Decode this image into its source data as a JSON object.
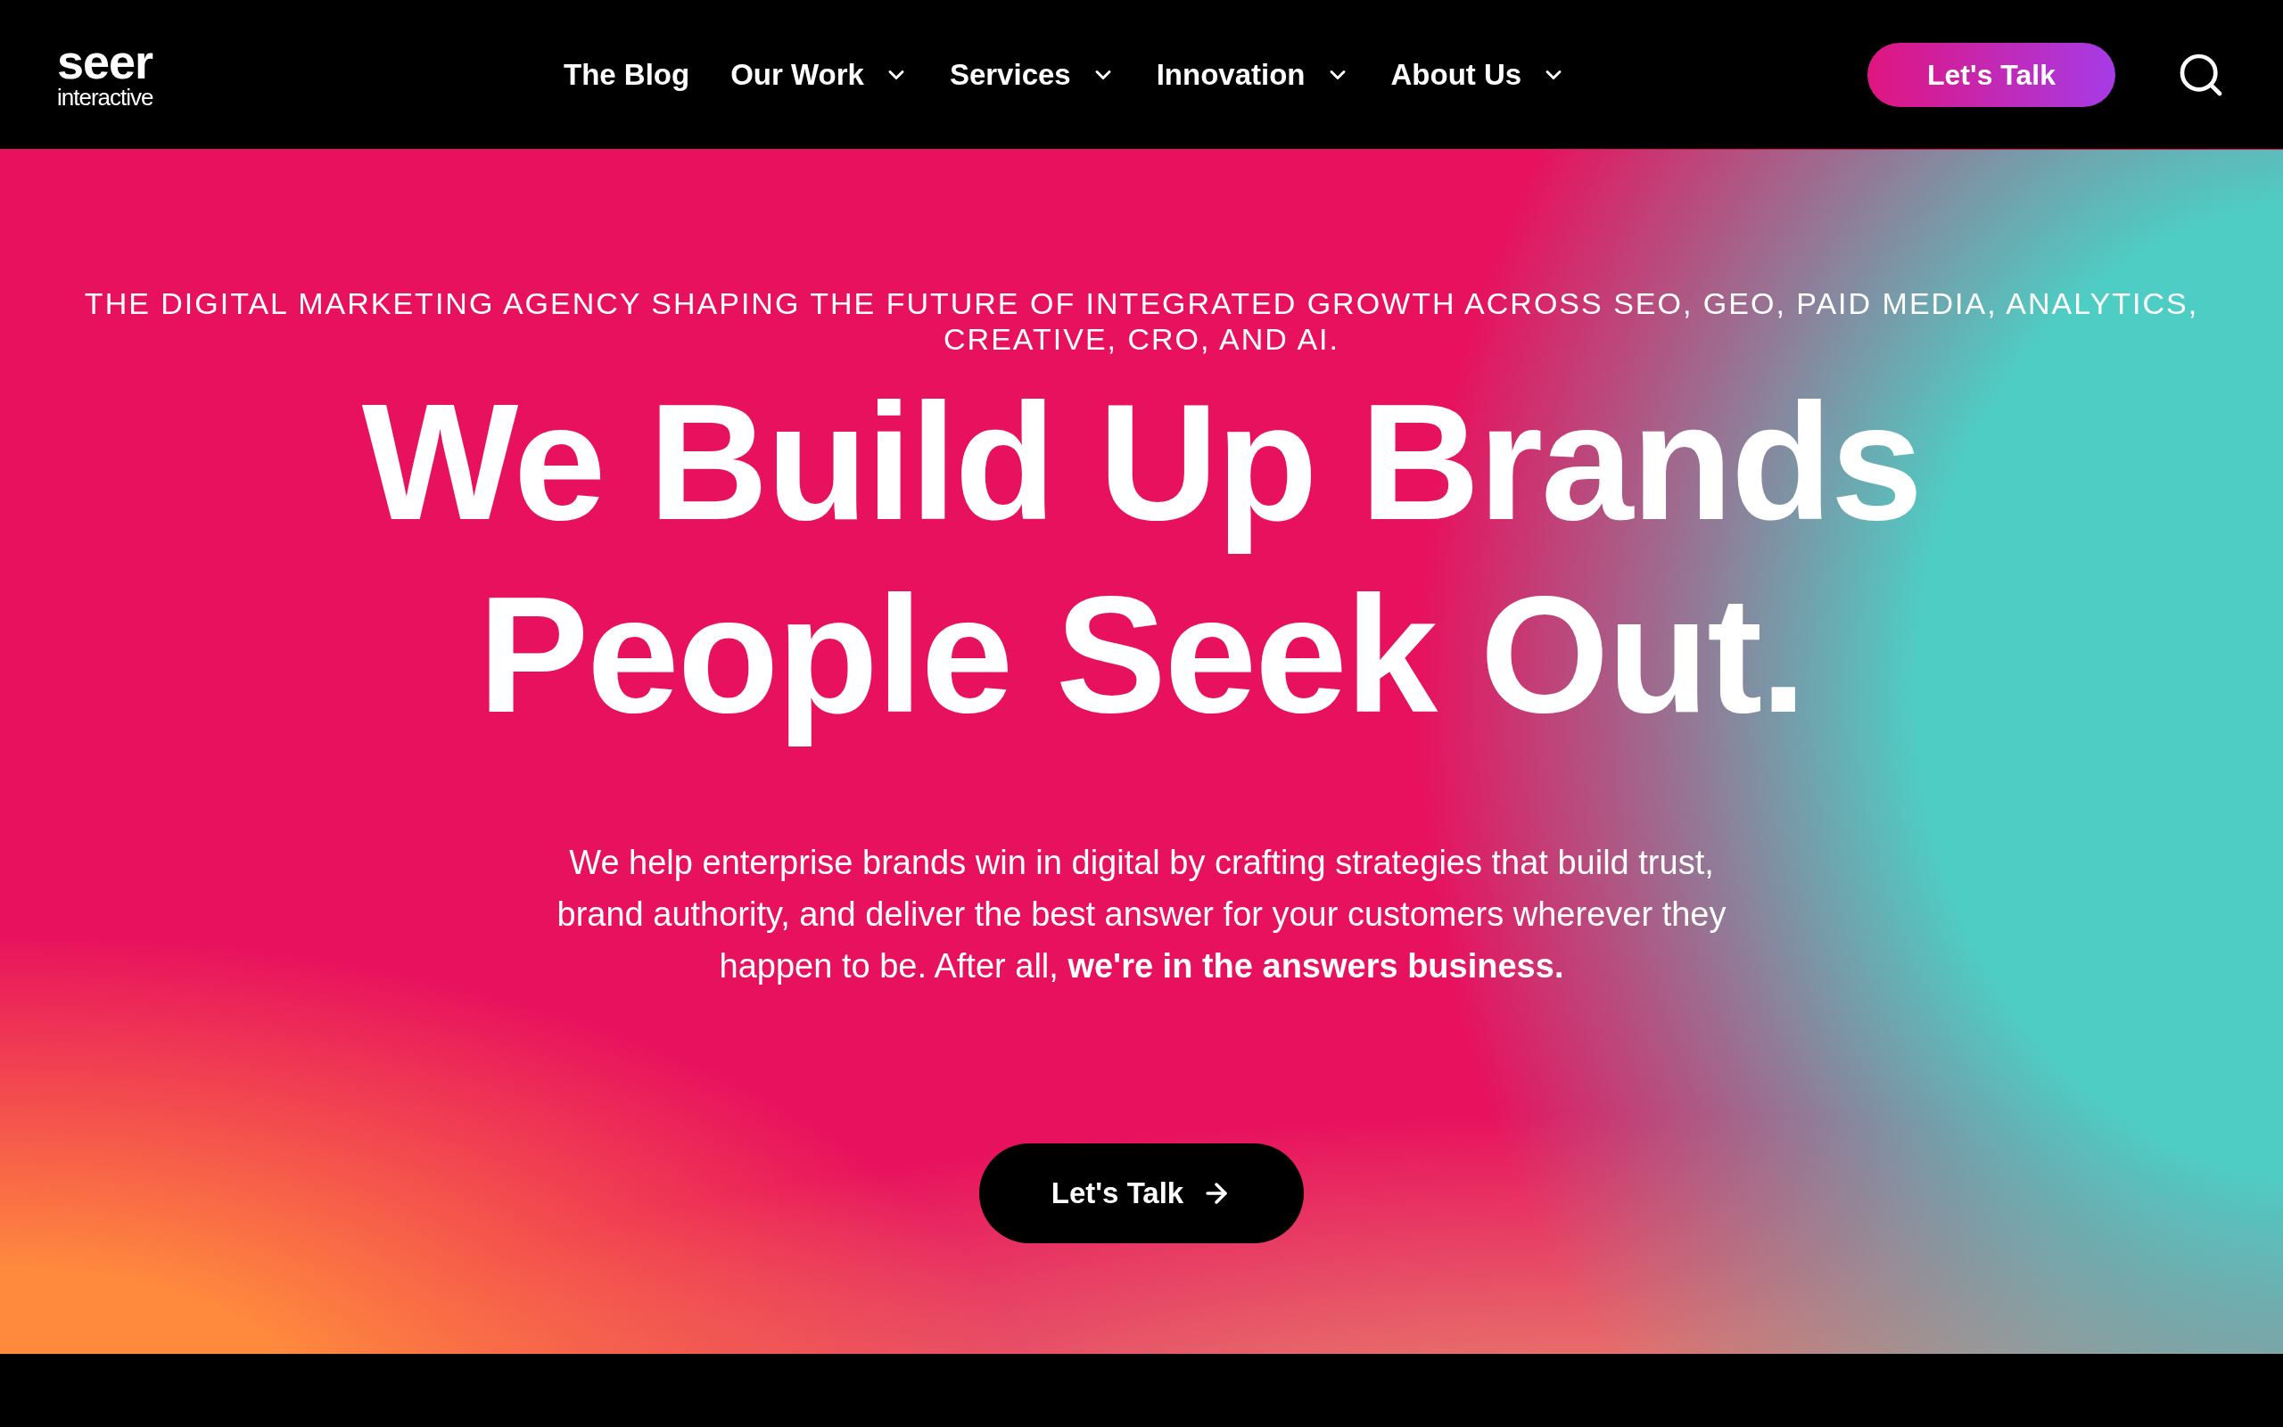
{
  "header": {
    "logo": {
      "word": "seer",
      "subword": "interactive"
    },
    "nav": [
      {
        "label": "The Blog",
        "dropdown": false
      },
      {
        "label": "Our Work",
        "dropdown": true
      },
      {
        "label": "Services",
        "dropdown": true
      },
      {
        "label": "Innovation",
        "dropdown": true
      },
      {
        "label": "About Us",
        "dropdown": true
      }
    ],
    "cta": "Let's Talk"
  },
  "hero": {
    "tagline": "THE DIGITAL MARKETING AGENCY SHAPING THE FUTURE OF INTEGRATED GROWTH ACROSS SEO, GEO, PAID MEDIA, ANALYTICS, CREATIVE, CRO, AND AI.",
    "headline": [
      "We Build Up Brands",
      "People Seek Out."
    ],
    "body": "We help enterprise brands win in digital by crafting strategies that build trust, brand authority, and deliver the best answer for your customers wherever they happen to be. After all, **we're in the answers business.**",
    "button": {
      "label": "Let's Talk",
      "arrow": true
    }
  }
}
